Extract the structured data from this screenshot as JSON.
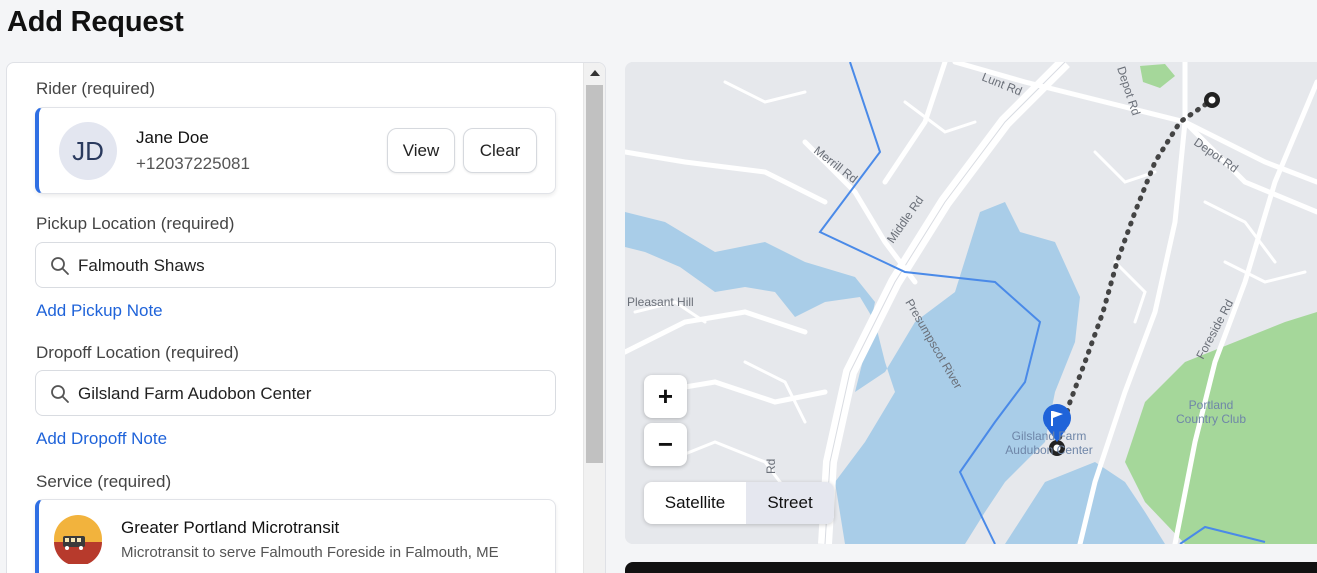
{
  "page": {
    "title": "Add Request"
  },
  "rider": {
    "label": "Rider (required)",
    "initials": "JD",
    "name": "Jane Doe",
    "phone": "+12037225081",
    "view_label": "View",
    "clear_label": "Clear"
  },
  "pickup": {
    "label": "Pickup Location (required)",
    "value": "Falmouth Shaws",
    "note_link": "Add Pickup Note"
  },
  "dropoff": {
    "label": "Dropoff Location (required)",
    "value": "Gilsland Farm Audobon Center",
    "note_link": "Add Dropoff Note"
  },
  "service": {
    "label": "Service (required)",
    "name": "Greater Portland Microtransit",
    "description": "Microtransit to serve Falmouth Foreside in Falmouth, ME"
  },
  "map": {
    "zoom_in_label": "+",
    "zoom_out_label": "−",
    "satellite_label": "Satellite",
    "street_label": "Street",
    "selected_view": "Street",
    "labels": {
      "lunt": "Lunt Rd",
      "depot_rd_top": "Depot Rd",
      "depot_rd": "Depot Rd",
      "merrill": "Merrill Rd",
      "middle": "Middle Rd",
      "pleasant_hill": "Pleasant Hill",
      "river": "Presumpscot River",
      "foreside": "Foreside Rd",
      "gilsland_1": "Gilsland Farm",
      "gilsland_2": "Audubon Center",
      "portland_1": "Portland",
      "portland_2": "Country Club",
      "rd_fragment": "Rd"
    }
  },
  "colors": {
    "accent": "#2f6fe3",
    "link": "#1f63d9",
    "water": "#a9cde8",
    "park": "#a5d79a",
    "route": "#444444",
    "boundary": "#4a8ae8"
  }
}
